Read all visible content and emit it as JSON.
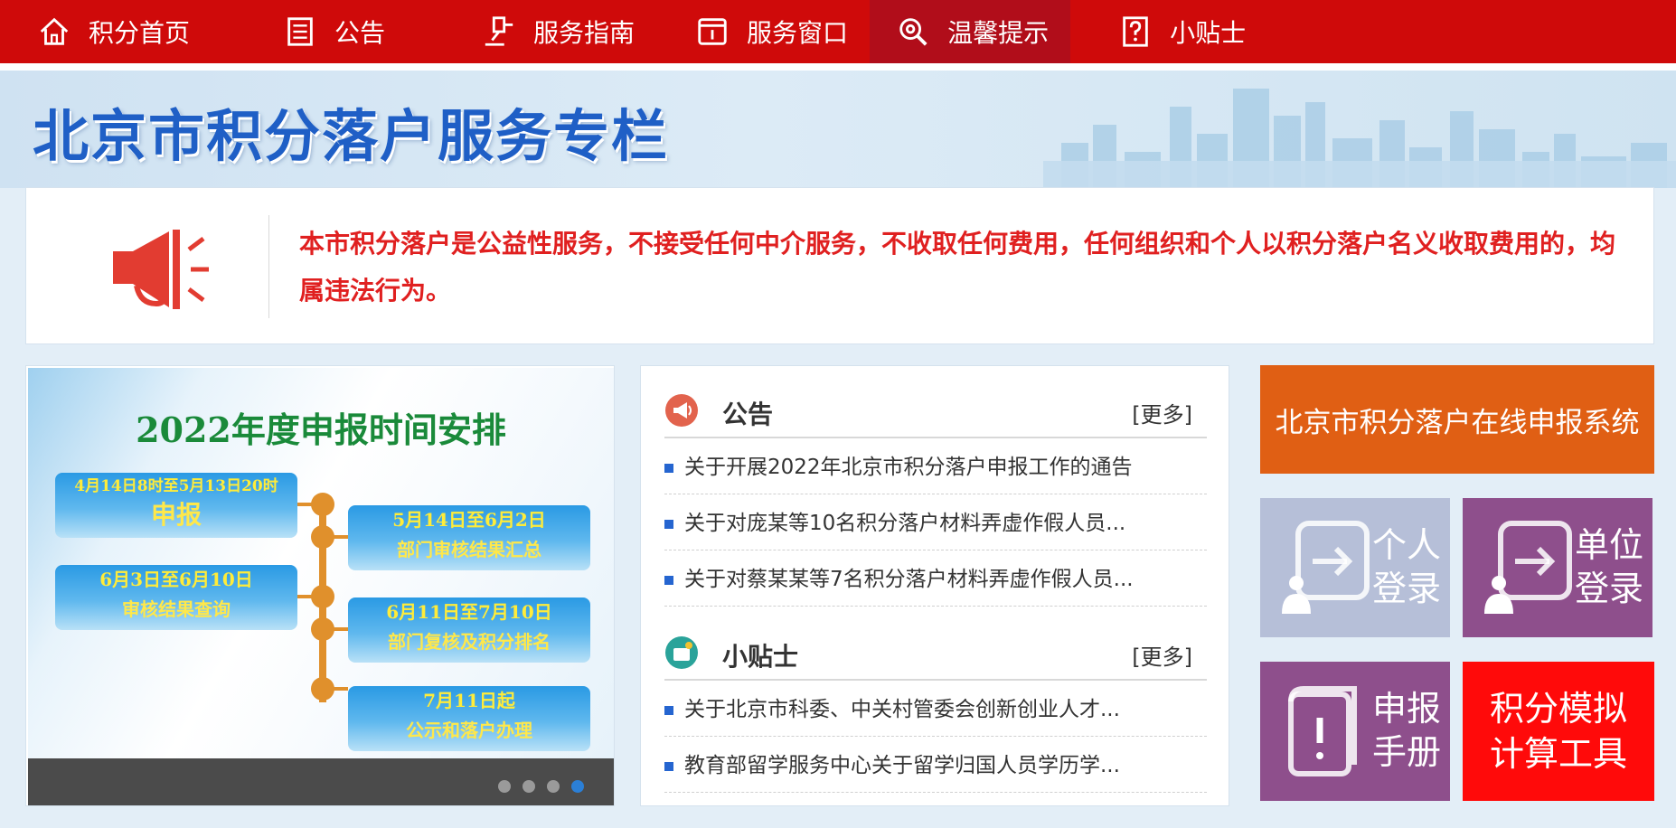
{
  "nav": {
    "items": [
      {
        "label": "积分首页",
        "icon": "home-icon"
      },
      {
        "label": "公告",
        "icon": "document-icon"
      },
      {
        "label": "服务指南",
        "icon": "gavel-icon"
      },
      {
        "label": "服务窗口",
        "icon": "window-icon"
      },
      {
        "label": "温馨提示",
        "icon": "search-gear-icon",
        "active": true
      },
      {
        "label": "小贴士",
        "icon": "question-icon"
      }
    ],
    "bg_color": "#cf0a0a"
  },
  "banner": {
    "title": "北京市积分落户服务专栏"
  },
  "notice": {
    "text": "本市积分落户是公益性服务，不接受任何中介服务，不收取任何费用，任何组织和个人以积分落户名义收取费用的，均属违法行为。"
  },
  "slider": {
    "title": "2022年度申报时间安排",
    "stages": [
      {
        "date": "4月14日8时至5月13日20时",
        "label": "申报"
      },
      {
        "date": "5月14日至6月2日",
        "label": "部门审核结果汇总"
      },
      {
        "date": "6月3日至6月10日",
        "label": "审核结果查询"
      },
      {
        "date": "6月11日至7月10日",
        "label": "部门复核及积分排名"
      },
      {
        "date": "7月11日起",
        "label": "公示和落户办理"
      }
    ],
    "dots": 4,
    "active_dot": 4
  },
  "announcements": {
    "title": "公告",
    "more": "[更多]",
    "items": [
      "关于开展2022年北京市积分落户申报工作的通告",
      "关于对庞某等10名积分落户材料弄虚作假人员...",
      "关于对蔡某某等7名积分落户材料弄虚作假人员..."
    ]
  },
  "tips": {
    "title": "小贴士",
    "more": "[更多]",
    "items": [
      "关于北京市科委、中关村管委会创新创业人才...",
      "教育部留学服务中心关于留学归国人员学历学..."
    ]
  },
  "tiles": {
    "online": "北京市积分落户在线申报系统",
    "personal_line1": "个人",
    "personal_line2": "登录",
    "unit_line1": "单位",
    "unit_line2": "登录",
    "manual_line1": "申报",
    "manual_line2": "手册",
    "calc_line1": "积分模拟",
    "calc_line2": "计算工具"
  }
}
